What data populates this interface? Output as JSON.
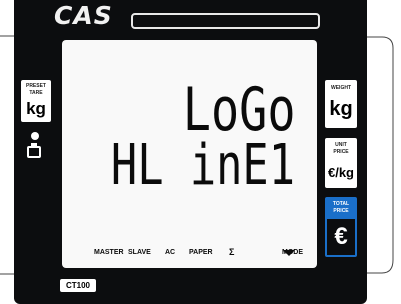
{
  "brand": {
    "logo_text": "CAS"
  },
  "display": {
    "line1": "LoGo",
    "line2": "HL inE1",
    "indicators": [
      "MASTER",
      "SLAVE",
      "AC",
      "PAPER",
      "Σ",
      "MODE"
    ]
  },
  "left_panel": {
    "preset_label": "PRESET",
    "tare_label": "TARE",
    "unit": "kg",
    "power_dot_icon": "dot-icon",
    "battery_icon": "battery-icon"
  },
  "right_panel": {
    "weight": {
      "label": "WEIGHT",
      "unit": "kg"
    },
    "unit_price": {
      "label_line1": "UNIT",
      "label_line2": "PRICE",
      "unit": "€/kg"
    },
    "total_price": {
      "label_line1": "TOTAL",
      "label_line2": "PRICE",
      "unit": "€"
    }
  },
  "model": "CT100",
  "colors": {
    "panel": "#0c0d0f",
    "lcd_background": "#f9f9f9",
    "total_accent": "#1a6fc9"
  }
}
